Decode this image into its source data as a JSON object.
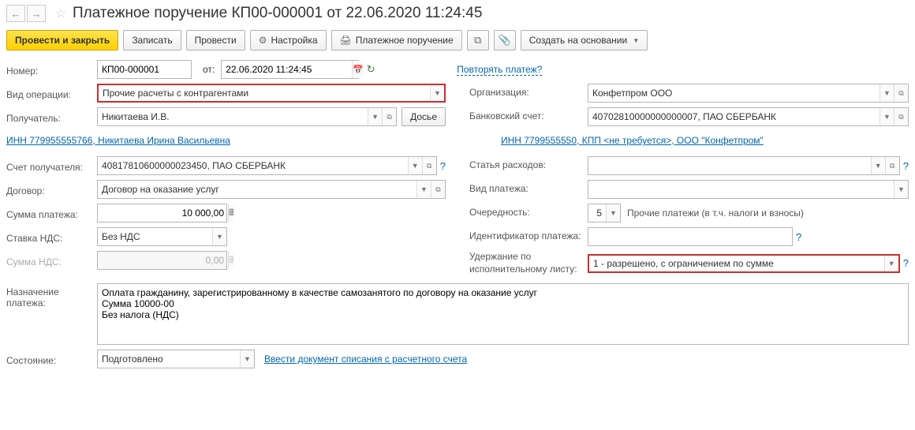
{
  "header": {
    "title": "Платежное поручение КП00-000001 от 22.06.2020 11:24:45"
  },
  "toolbar": {
    "post_close": "Провести и закрыть",
    "write": "Записать",
    "post": "Провести",
    "settings": "Настройка",
    "print": "Платежное поручение",
    "create_based": "Создать на основании"
  },
  "left": {
    "number_lbl": "Номер:",
    "number": "КП00-000001",
    "from_lbl": "от:",
    "date": "22.06.2020 11:24:45",
    "repeat_link": "Повторять платеж?",
    "optype_lbl": "Вид операции:",
    "optype": "Прочие расчеты с контрагентами",
    "recipient_lbl": "Получатель:",
    "recipient": "Никитаева И.В.",
    "dossier": "Досье",
    "inn_link": "ИНН 779955555766, Никитаева Ирина Васильевна",
    "account_lbl": "Счет получателя:",
    "account": "40817810600000023450, ПАО СБЕРБАНК",
    "contract_lbl": "Договор:",
    "contract": "Договор на оказание услуг",
    "sum_lbl": "Сумма платежа:",
    "sum": "10 000,00",
    "vat_rate_lbl": "Ставка НДС:",
    "vat_rate": "Без НДС",
    "vat_sum_lbl": "Сумма НДС:",
    "vat_sum": "0,00",
    "purpose_lbl": "Назначение платежа:",
    "purpose": "Оплата гражданину, зарегистрированному в качестве самозанятого по договору на оказание услуг\nСумма 10000-00\nБез налога (НДС)",
    "state_lbl": "Состояние:",
    "state": "Подготовлено",
    "state_link": "Ввести документ списания с расчетного счета"
  },
  "right": {
    "org_lbl": "Организация:",
    "org": "Конфетпром ООО",
    "bank_lbl": "Банковский счет:",
    "bank": "40702810000000000007, ПАО СБЕРБАНК",
    "inn_link": "ИНН 7799555550, КПП <не требуется>, ООО \"Конфетпром\"",
    "expense_lbl": "Статья расходов:",
    "paytype_lbl": "Вид платежа:",
    "priority_lbl": "Очередность:",
    "priority": "5",
    "priority_text": "Прочие платежи (в т.ч. налоги и взносы)",
    "ident_lbl": "Идентификатор платежа:",
    "hold_lbl": "Удержание по исполнительному листу:",
    "hold": "1 - разрешено, с ограничением по сумме"
  }
}
